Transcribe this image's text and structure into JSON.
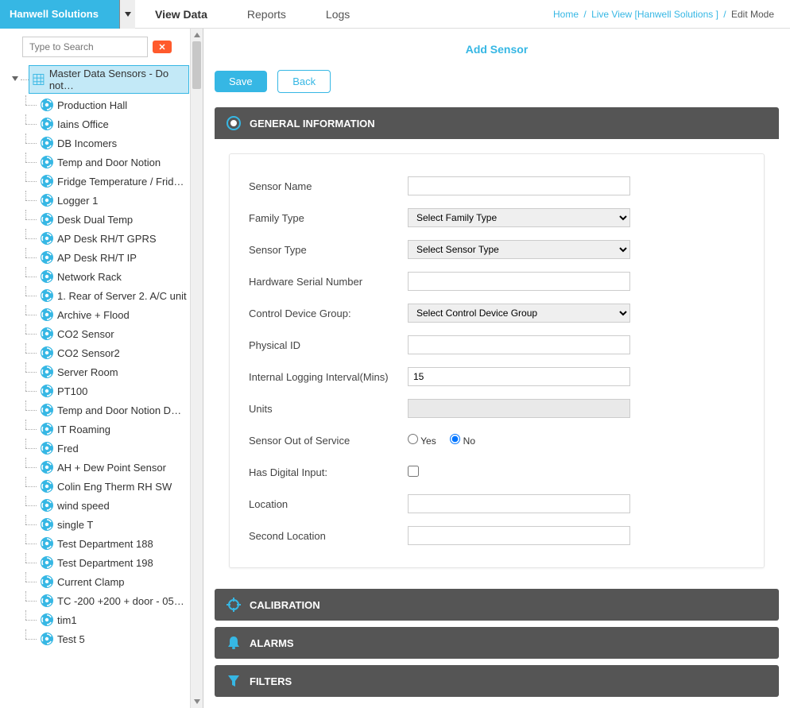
{
  "topnav": {
    "site_name": "Hanwell Solutions",
    "tabs": [
      "View Data",
      "Reports",
      "Logs"
    ],
    "active_tab": 0
  },
  "breadcrumb": {
    "home": "Home",
    "live": "Live View [Hanwell Solutions ]",
    "current": "Edit Mode"
  },
  "sidebar": {
    "search_placeholder": "Type to Search",
    "root": "Master Data Sensors - Do not…",
    "items": [
      "Production Hall",
      "Iains Office",
      "DB Incomers",
      "Temp and Door Notion",
      "Fridge Temperature / Frid…",
      "Logger 1",
      "Desk Dual Temp",
      "AP Desk RH/T GPRS",
      "AP Desk RH/T IP",
      "Network Rack",
      "1. Rear of Server 2. A/C unit",
      "Archive + Flood",
      "CO2 Sensor",
      "CO2 Sensor2",
      "Server Room",
      "PT100",
      "Temp and Door Notion D…",
      "IT Roaming",
      "Fred",
      "AH + Dew Point Sensor",
      "Colin Eng Therm RH SW",
      "wind speed",
      "single T",
      "Test Department 188",
      "Test Department 198",
      "Current Clamp",
      "TC -200 +200 + door - 05…",
      "tim1",
      "Test 5"
    ]
  },
  "main": {
    "title": "Add Sensor",
    "save": "Save",
    "back": "Back"
  },
  "panels": {
    "general": "GENERAL INFORMATION",
    "calibration": "CALIBRATION",
    "alarms": "ALARMS",
    "filters": "FILTERS"
  },
  "form": {
    "sensor_name": {
      "label": "Sensor Name",
      "value": ""
    },
    "family_type": {
      "label": "Family Type",
      "selected": "Select Family Type"
    },
    "sensor_type": {
      "label": "Sensor Type",
      "selected": "Select Sensor Type"
    },
    "hw_serial": {
      "label": "Hardware Serial Number",
      "value": ""
    },
    "control_group": {
      "label": "Control Device Group:",
      "selected": "Select Control Device Group"
    },
    "physical_id": {
      "label": "Physical ID",
      "value": ""
    },
    "log_interval": {
      "label": "Internal Logging Interval(Mins)",
      "value": "15"
    },
    "units": {
      "label": "Units",
      "value": ""
    },
    "out_of_service": {
      "label": "Sensor Out of Service",
      "yes": "Yes",
      "no": "No",
      "value": "no"
    },
    "has_digital": {
      "label": "Has Digital Input:",
      "value": false
    },
    "location": {
      "label": "Location",
      "value": ""
    },
    "second_location": {
      "label": "Second Location",
      "value": ""
    }
  }
}
